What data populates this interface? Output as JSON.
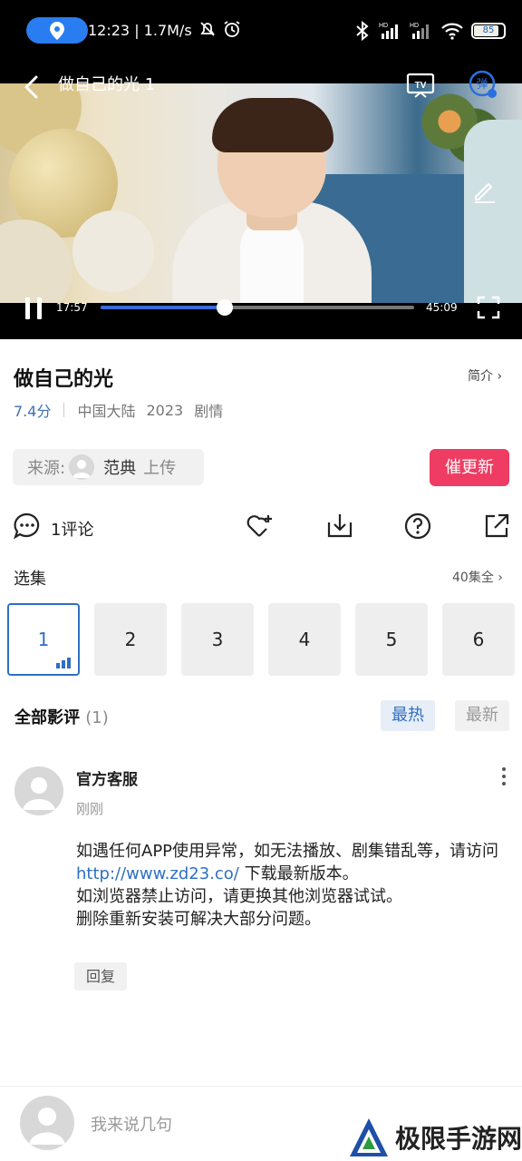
{
  "status_bar": {
    "time": "12:23",
    "speed": "1.7M/s",
    "battery": "85",
    "accent_color": "#2a7df0"
  },
  "player": {
    "title": "做自己的光 1",
    "current_time": "17:57",
    "total_time": "45:09",
    "progress": 0.397,
    "progress_color": "#3a6bd6"
  },
  "show": {
    "title": "做自己的光",
    "intro_label": "简介 ›",
    "score": "7.4分",
    "region": "中国大陆",
    "year": "2023",
    "genre": "剧情"
  },
  "source": {
    "label": "来源:",
    "uploader": "范典",
    "action": "上传"
  },
  "urge_button": "催更新",
  "actions": {
    "comment_count": "1评论"
  },
  "episodes": {
    "label": "选集",
    "all_label": "40集全 ›",
    "items": [
      "1",
      "2",
      "3",
      "4",
      "5",
      "6"
    ],
    "active_index": 0
  },
  "reviews": {
    "header": "全部影评",
    "count": "(1)",
    "tab_hot": "最热",
    "tab_new": "最新"
  },
  "comment": {
    "author": "官方客服",
    "time": "刚刚",
    "line1": "如遇任何APP使用异常，如无法播放、剧集错乱等，请访问",
    "link": "http://www.zd23.co/",
    "line2": " 下载最新版本。",
    "line3": "如浏览器禁止访问，请更换其他浏览器试试。",
    "line4": "删除重新安装可解决大部分问题。",
    "reply": "回复"
  },
  "composer": {
    "placeholder": "我来说几句"
  },
  "watermark": "极限手游网"
}
